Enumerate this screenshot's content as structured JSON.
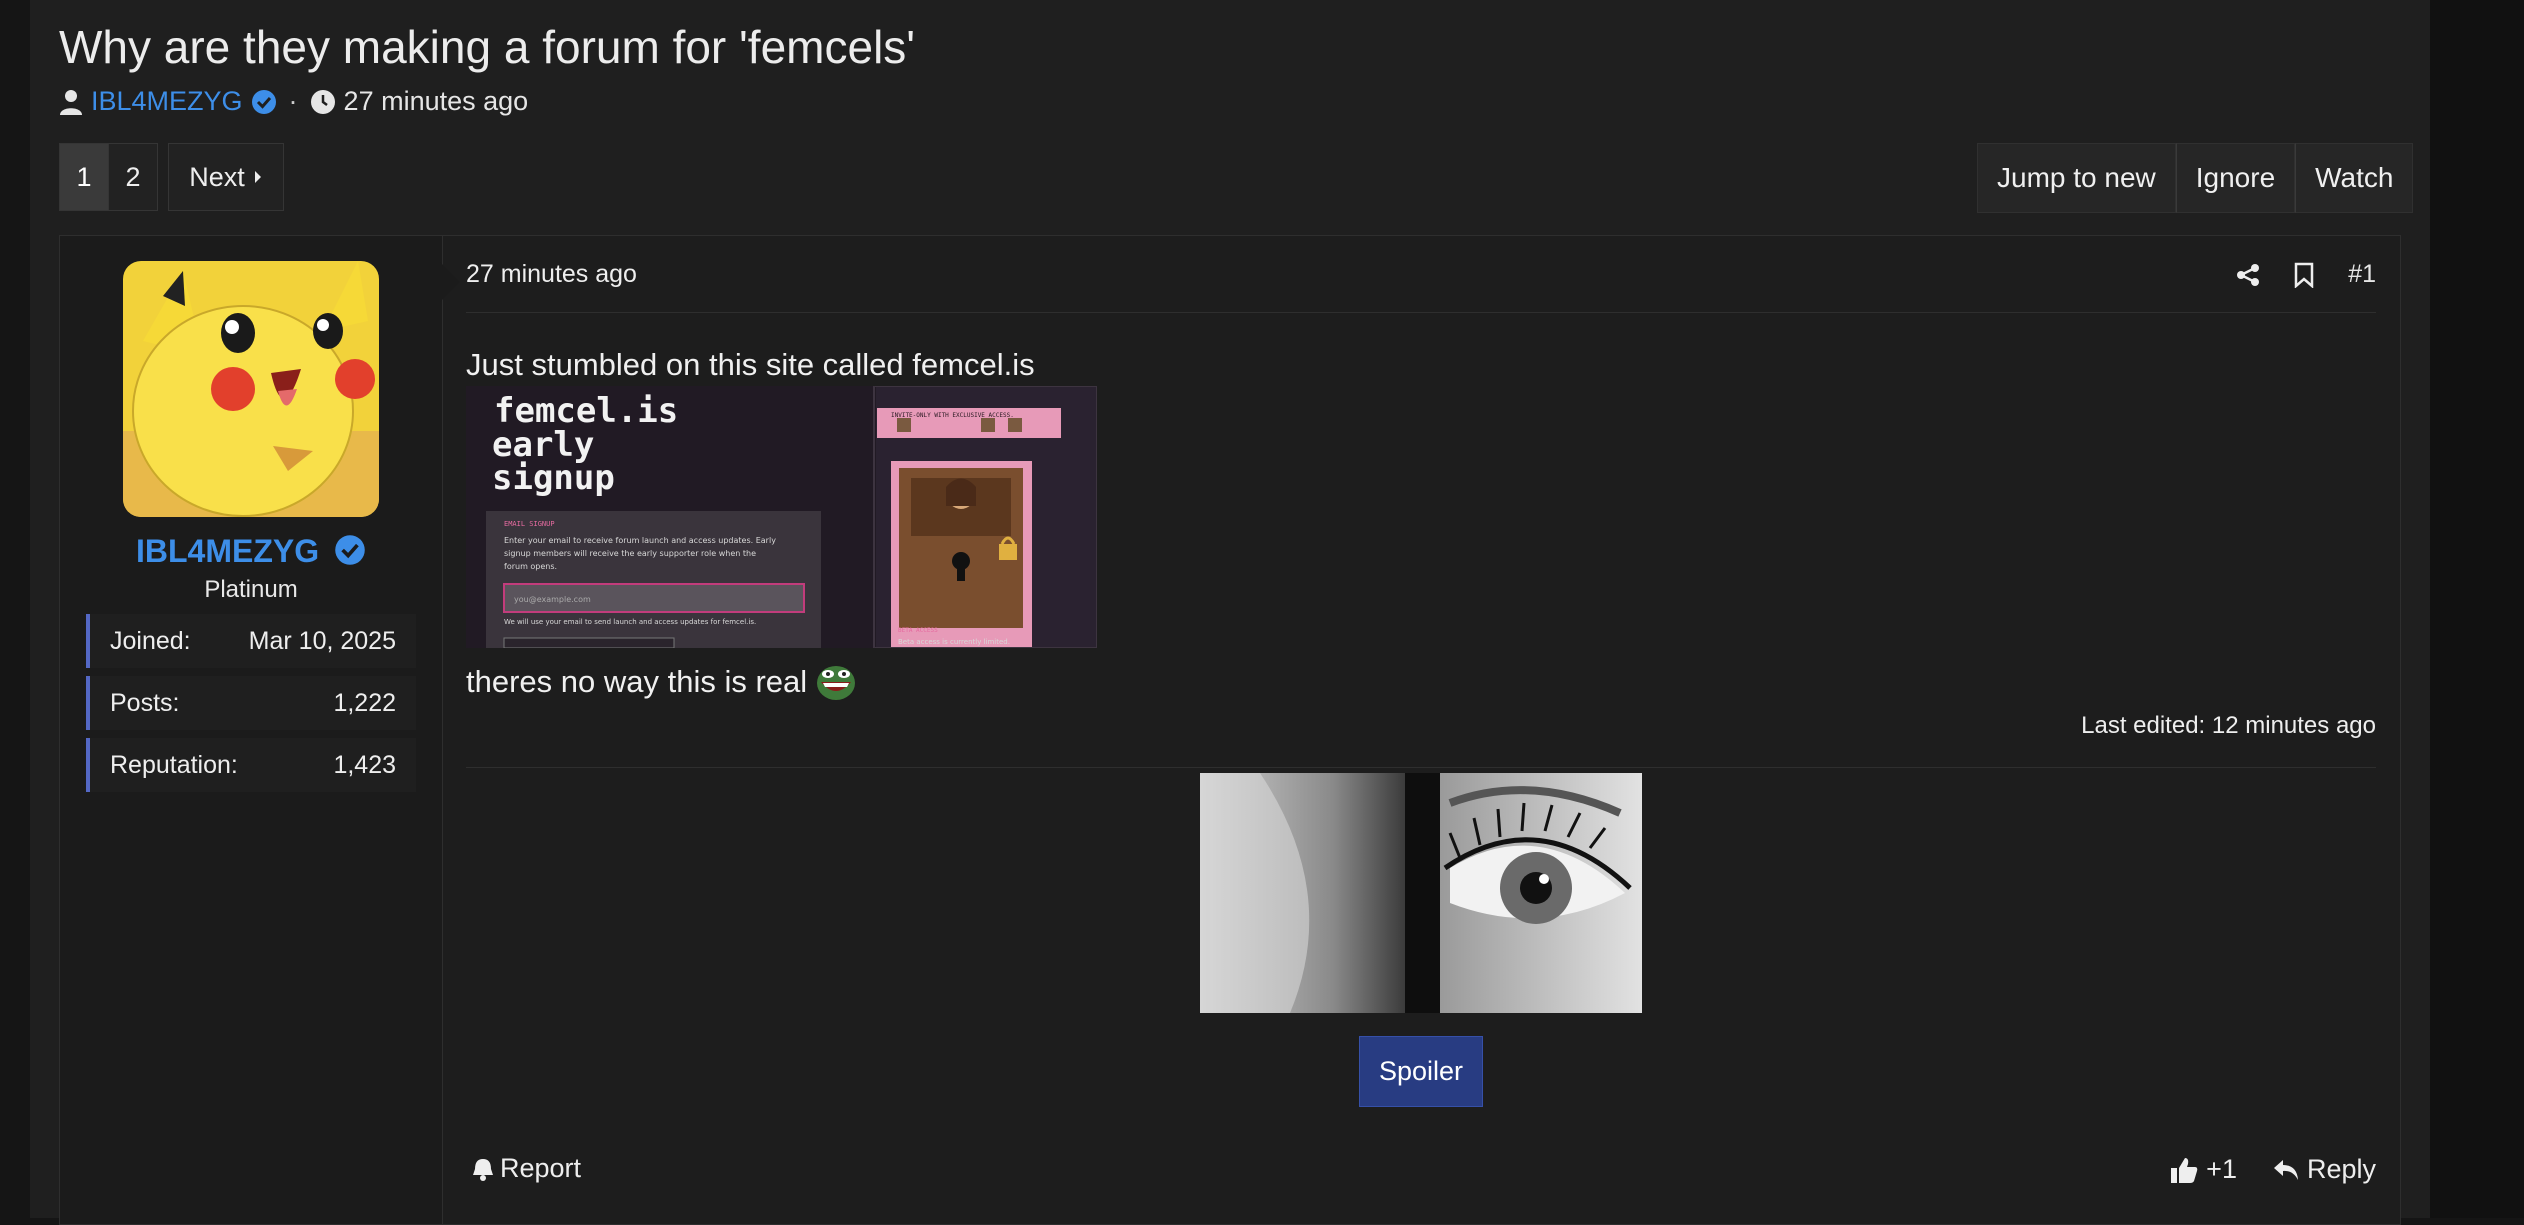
{
  "thread": {
    "title": "Why are they making a forum for 'femcels'",
    "author": "IBL4MEZYG",
    "time": "27 minutes ago",
    "separator": "·"
  },
  "pagination": {
    "pages": [
      "1",
      "2"
    ],
    "current": "1",
    "next_label": "Next"
  },
  "actions": {
    "jump": "Jump to new",
    "ignore": "Ignore",
    "watch": "Watch"
  },
  "user": {
    "name": "IBL4MEZYG",
    "role": "Platinum",
    "stats": [
      {
        "label": "Joined:",
        "value": "Mar 10, 2025"
      },
      {
        "label": "Posts:",
        "value": "1,222"
      },
      {
        "label": "Reputation:",
        "value": "1,423"
      }
    ]
  },
  "post": {
    "time": "27 minutes ago",
    "number": "#1",
    "line1": "Just stumbled on this site called femcel.is",
    "line2": "theres no way this is real",
    "edited": "Last edited: 12 minutes ago",
    "spoiler_label": "Spoiler",
    "report_label": "Report",
    "like_count": "+1",
    "reply_label": "Reply"
  },
  "embedded_screenshot": {
    "heading": [
      "femcel.is",
      "early",
      "signup"
    ],
    "small_label": "EMAIL SIGNUP",
    "desc": [
      "Enter your email to receive forum launch and access updates. Early",
      "signup members will receive the early supporter role when the",
      "forum opens."
    ],
    "email_placeholder": "you@example.com",
    "note": "We will use your email to send launch and access updates for femcel.is.",
    "banner": "INVITE-ONLY WITH EXCLUSIVE ACCESS.",
    "beta_label": "BETA ACCESS",
    "beta_text": "Beta access is currently limited."
  },
  "colors": {
    "accent": "#3d8ee8",
    "spoiler": "#283c82",
    "stat_border": "#5468c5"
  }
}
